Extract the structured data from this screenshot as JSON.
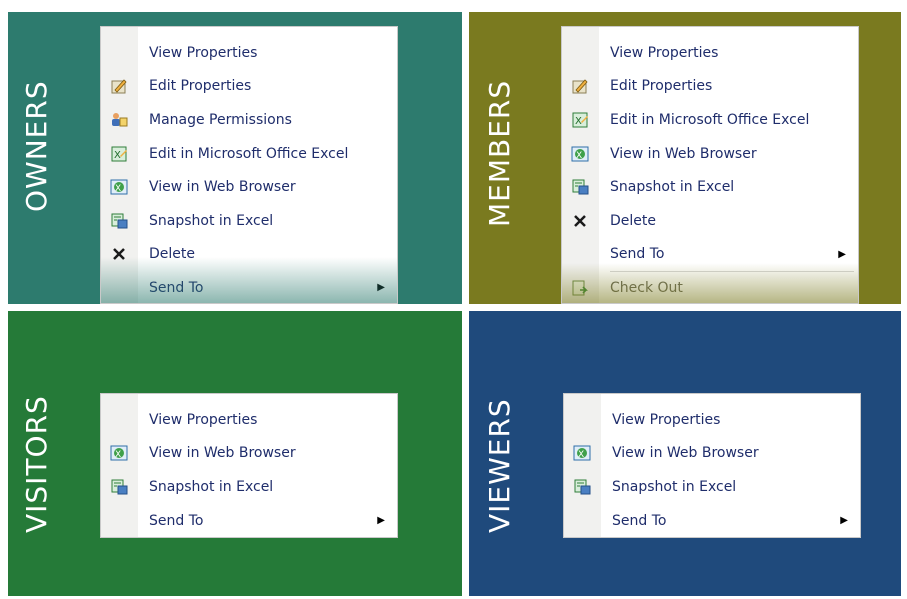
{
  "panels": {
    "owners": {
      "label": "OWNERS",
      "color": "#2d7b6e",
      "items": [
        {
          "label": "View Properties",
          "icon": "none"
        },
        {
          "label": "Edit Properties",
          "icon": "edit-properties-icon"
        },
        {
          "label": "Manage Permissions",
          "icon": "permissions-icon"
        },
        {
          "label": "Edit in Microsoft Office Excel",
          "icon": "excel-edit-icon"
        },
        {
          "label": "View in Web Browser",
          "icon": "web-browser-icon"
        },
        {
          "label": "Snapshot in Excel",
          "icon": "excel-snapshot-icon"
        },
        {
          "label": "Delete",
          "icon": "delete-icon"
        },
        {
          "label": "Send To",
          "icon": "none",
          "submenu": "▶"
        }
      ]
    },
    "members": {
      "label": "MEMBERS",
      "color": "#7a7a1f",
      "items": [
        {
          "label": "View Properties",
          "icon": "none"
        },
        {
          "label": "Edit Properties",
          "icon": "edit-properties-icon"
        },
        {
          "label": "Edit in Microsoft Office Excel",
          "icon": "excel-edit-icon"
        },
        {
          "label": "View in Web Browser",
          "icon": "web-browser-icon"
        },
        {
          "label": "Snapshot in Excel",
          "icon": "excel-snapshot-icon"
        },
        {
          "label": "Delete",
          "icon": "delete-icon"
        },
        {
          "label": "Send To",
          "icon": "none",
          "submenu": "▶"
        },
        {
          "label": "Check Out",
          "icon": "check-out-icon"
        }
      ]
    },
    "visitors": {
      "label": "VISITORS",
      "color": "#257a38",
      "items": [
        {
          "label": "View Properties",
          "icon": "none"
        },
        {
          "label": "View in Web Browser",
          "icon": "web-browser-icon"
        },
        {
          "label": "Snapshot in Excel",
          "icon": "excel-snapshot-icon"
        },
        {
          "label": "Send To",
          "icon": "none",
          "submenu": "▶"
        }
      ]
    },
    "viewers": {
      "label": "VIEWERS",
      "color": "#1f4a7c",
      "items": [
        {
          "label": "View Properties",
          "icon": "none"
        },
        {
          "label": "View in Web Browser",
          "icon": "web-browser-icon"
        },
        {
          "label": "Snapshot in Excel",
          "icon": "excel-snapshot-icon"
        },
        {
          "label": "Send To",
          "icon": "none",
          "submenu": "▶"
        }
      ]
    }
  }
}
